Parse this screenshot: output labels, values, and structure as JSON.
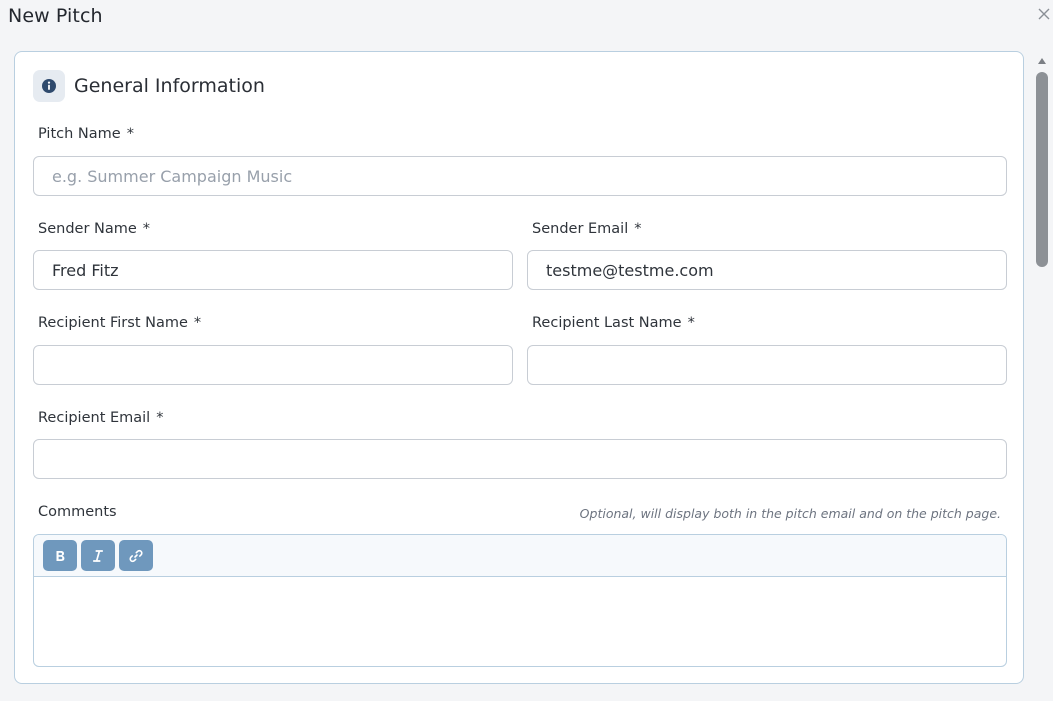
{
  "dialog": {
    "title": "New Pitch"
  },
  "section": {
    "title": "General Information",
    "icon": "info-icon"
  },
  "fields": {
    "pitch_name": {
      "label": "Pitch Name",
      "required_mark": "*",
      "value": "",
      "placeholder": "e.g. Summer Campaign Music"
    },
    "sender_name": {
      "label": "Sender Name",
      "required_mark": "*",
      "value": "Fred Fitz",
      "placeholder": ""
    },
    "sender_email": {
      "label": "Sender Email",
      "required_mark": "*",
      "value": "testme@testme.com",
      "placeholder": ""
    },
    "recipient_first_name": {
      "label": "Recipient First Name",
      "required_mark": "*",
      "value": "",
      "placeholder": ""
    },
    "recipient_last_name": {
      "label": "Recipient Last Name",
      "required_mark": "*",
      "value": "",
      "placeholder": ""
    },
    "recipient_email": {
      "label": "Recipient Email",
      "required_mark": "*",
      "value": "",
      "placeholder": ""
    },
    "comments": {
      "label": "Comments",
      "hint": "Optional, will display both in the pitch email and on the pitch page."
    }
  },
  "editor_toolbar": [
    "bold-icon",
    "italic-icon",
    "link-icon"
  ],
  "colors": {
    "accent": "#6f98bd",
    "card_border": "#b9cfe0",
    "info_icon": "#2f4a6d"
  }
}
